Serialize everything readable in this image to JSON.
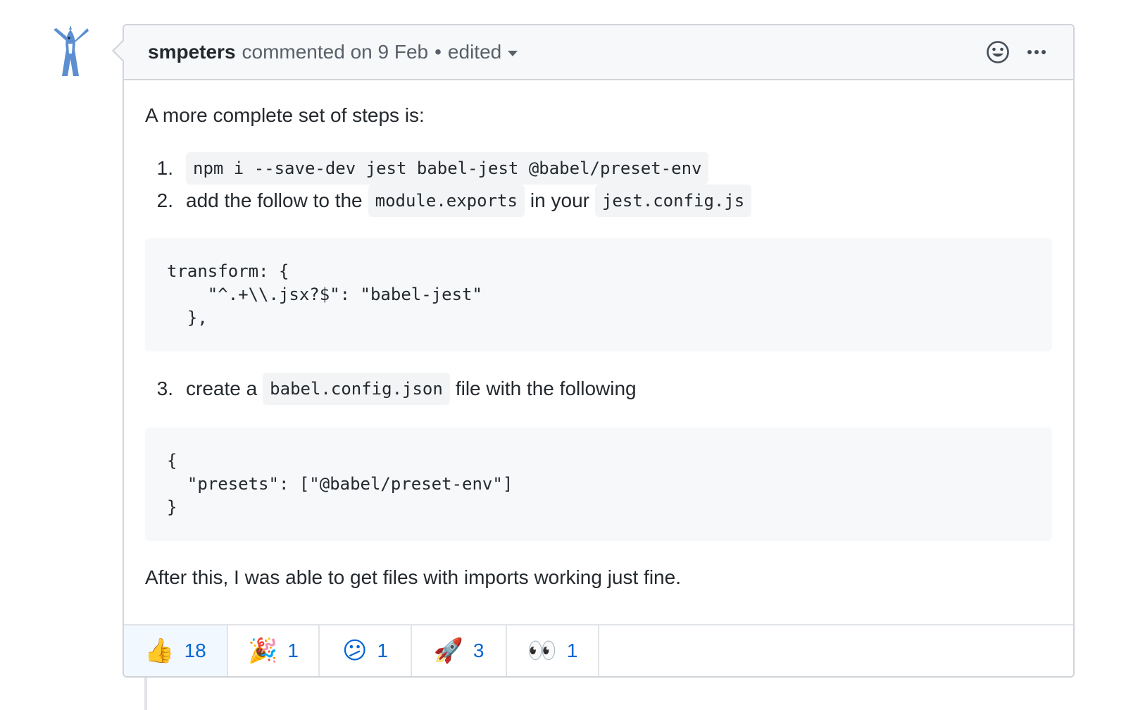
{
  "comment": {
    "author": "smpeters",
    "meta": "commented on 9 Feb",
    "separator": "•",
    "edited": "edited",
    "icons": [
      "smiley-icon",
      "kebab-horizontal-icon"
    ]
  },
  "body": {
    "intro": "A more complete set of steps is:",
    "step1": {
      "num": "1.",
      "code": "npm i --save-dev jest babel-jest @babel/preset-env"
    },
    "step2": {
      "num": "2.",
      "text_a": "add the follow to the",
      "code_a": "module.exports",
      "text_b": "in your",
      "code_b": "jest.config.js"
    },
    "code_block_1": "transform: {\n    \"^.+\\\\.jsx?$\": \"babel-jest\"\n  },",
    "step3": {
      "num": "3.",
      "text_a": "create a",
      "code_a": "babel.config.json",
      "text_b": "file with the following"
    },
    "code_block_2": "{\n  \"presets\": [\"@babel/preset-env\"]\n}",
    "outro": "After this, I was able to get files with imports working just fine."
  },
  "reactions": [
    {
      "emoji": "👍",
      "name": "thumbs-up",
      "count": "18",
      "active": true
    },
    {
      "emoji": "🎉",
      "name": "hooray",
      "count": "1",
      "active": false
    },
    {
      "emoji": "😕",
      "name": "confused",
      "count": "1",
      "active": false
    },
    {
      "emoji": "🚀",
      "name": "rocket",
      "count": "3",
      "active": false
    },
    {
      "emoji": "👀",
      "name": "eyes",
      "count": "1",
      "active": false
    }
  ],
  "colors": {
    "link_blue": "#0366d6",
    "border": "#d1d5da",
    "header_bg": "#f6f8fa",
    "reaction_active_bg": "#f1f8ff"
  }
}
